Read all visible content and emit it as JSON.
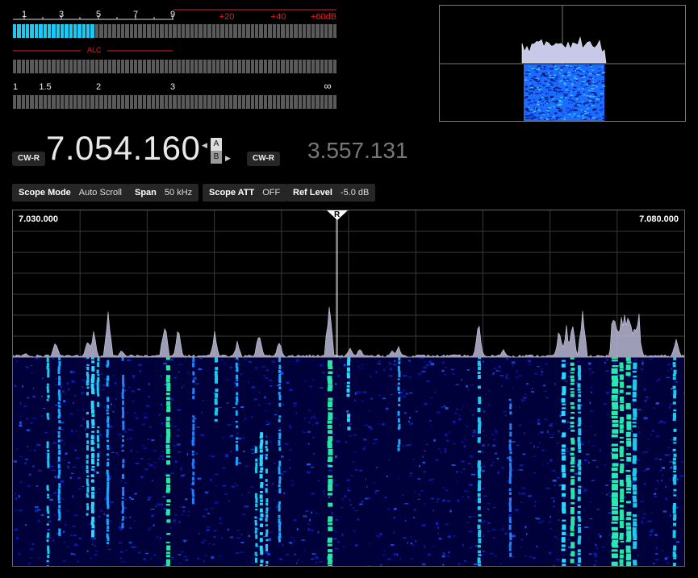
{
  "meters": {
    "s_meter": {
      "scale_left": [
        "1",
        "3",
        "5",
        "7",
        "9"
      ],
      "scale_right": [
        "+20",
        "+40",
        "+60dB"
      ],
      "level_fraction": 0.255
    },
    "alc": {
      "label": "ALC",
      "level_fraction": 0
    },
    "swr": {
      "scale": [
        "1",
        "1.5",
        "2",
        "3",
        "∞"
      ],
      "level_fraction": 0
    }
  },
  "vfo": {
    "main_mode": "CW-R",
    "main_freq": "7.054.160",
    "selector_a": "A",
    "selector_b": "B",
    "sub_mode": "CW-R",
    "sub_freq": "3.557.131"
  },
  "scope_params": [
    {
      "key": "Scope Mode",
      "value": "Auto Scroll"
    },
    {
      "key": "Span",
      "value": "50 kHz"
    },
    {
      "key": "Scope ATT",
      "value": "OFF"
    },
    {
      "key": "Ref Level",
      "value": "-5.0 dB"
    }
  ],
  "scope": {
    "start_freq": "7.030.000",
    "end_freq": "7.080.000",
    "marker_label": "R",
    "colors": {
      "trace": "#b9b9d8",
      "grid": "#3a3a3a",
      "waterfall_bg": "#00003a"
    }
  }
}
